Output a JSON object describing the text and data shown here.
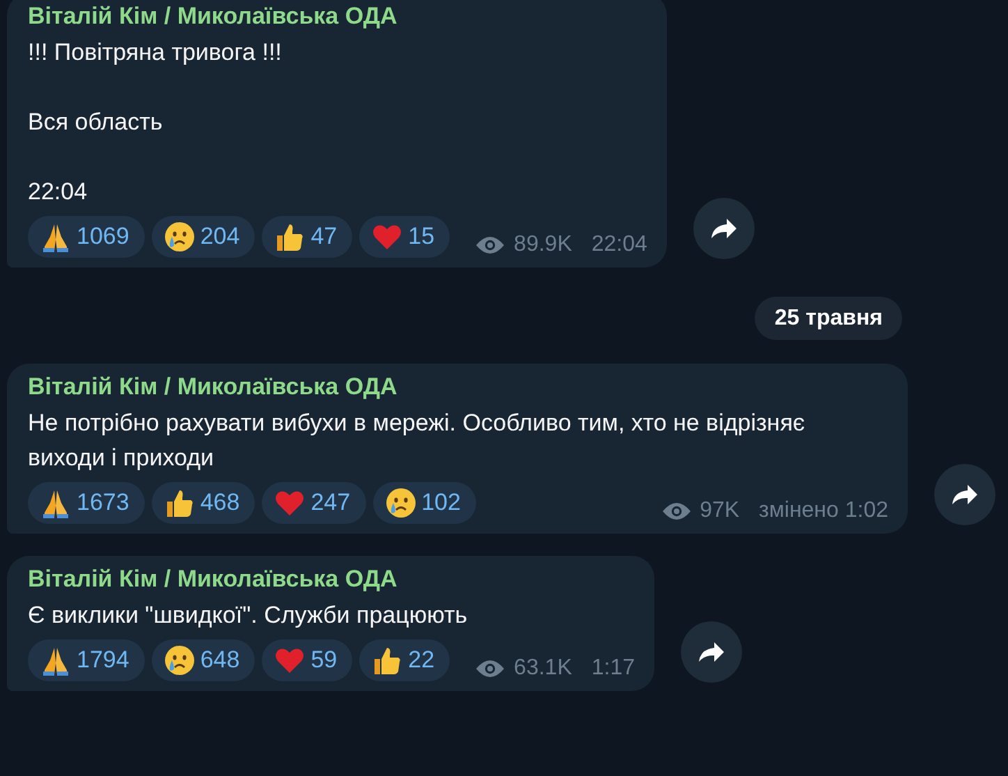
{
  "messages": [
    {
      "author": "Віталій Кім / Миколаївська ОДА",
      "text": "!!! Повітряна тривога !!!\n\nВся область\n\n22:04",
      "reactions": [
        {
          "kind": "pray",
          "count": "1069"
        },
        {
          "kind": "cry",
          "count": "204"
        },
        {
          "kind": "thumbs",
          "count": "47"
        },
        {
          "kind": "heart",
          "count": "15"
        }
      ],
      "views": "89.9K",
      "time": "22:04"
    },
    {
      "date": "25 травня"
    },
    {
      "author": "Віталій Кім / Миколаївська ОДА",
      "text": "Не потрібно рахувати вибухи в мережі. Особливо тим, хто не відрізняє виходи і приходи",
      "reactions": [
        {
          "kind": "pray",
          "count": "1673"
        },
        {
          "kind": "thumbs",
          "count": "468"
        },
        {
          "kind": "heart",
          "count": "247"
        },
        {
          "kind": "cry",
          "count": "102"
        }
      ],
      "views": "97K",
      "time": "змінено 1:02"
    },
    {
      "author": "Віталій Кім / Миколаївська ОДА",
      "text": "Є виклики \"швидкої\". Служби працюють",
      "reactions": [
        {
          "kind": "pray",
          "count": "1794"
        },
        {
          "kind": "cry",
          "count": "648"
        },
        {
          "kind": "heart",
          "count": "59"
        },
        {
          "kind": "thumbs",
          "count": "22"
        }
      ],
      "views": "63.1K",
      "time": "1:17"
    }
  ]
}
